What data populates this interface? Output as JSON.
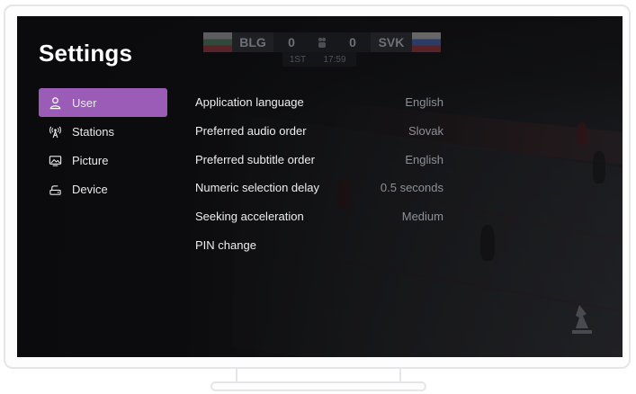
{
  "screen": {
    "title": "Settings"
  },
  "scorebug": {
    "home_team": "BLG",
    "home_score": "0",
    "away_score": "0",
    "away_team": "SVK",
    "period": "1ST",
    "clock": "17:59"
  },
  "sidebar": {
    "items": [
      {
        "label": "User",
        "icon": "user-icon",
        "active": true
      },
      {
        "label": "Stations",
        "icon": "antenna-icon",
        "active": false
      },
      {
        "label": "Picture",
        "icon": "picture-icon",
        "active": false
      },
      {
        "label": "Device",
        "icon": "device-icon",
        "active": false
      }
    ]
  },
  "settings": {
    "rows": [
      {
        "label": "Application language",
        "value": "English"
      },
      {
        "label": "Preferred audio order",
        "value": "Slovak"
      },
      {
        "label": "Preferred subtitle order",
        "value": "English"
      },
      {
        "label": "Numeric selection delay",
        "value": "0.5 seconds"
      },
      {
        "label": "Seeking acceleration",
        "value": "Medium"
      },
      {
        "label": "PIN change",
        "value": ""
      }
    ]
  },
  "colors": {
    "accent": "#9a5cb6",
    "background": "#0b0b0d",
    "text_primary": "#ffffff",
    "text_secondary": "#8e9098"
  }
}
